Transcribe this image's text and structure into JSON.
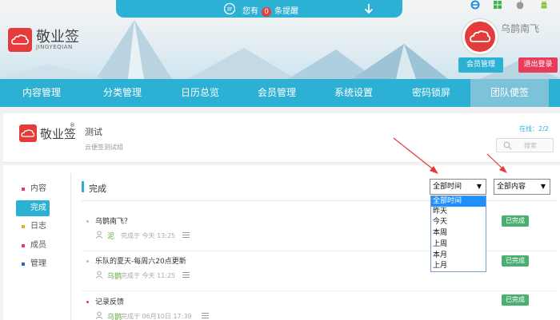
{
  "notice": {
    "prefix": "您有",
    "count": "0",
    "suffix": "条提醒"
  },
  "brand": {
    "name": "敬业签",
    "sub": "JINGYEQIAN"
  },
  "user": {
    "name": "乌鹊南飞",
    "member_btn": "会员管理",
    "logout_btn": "退出登录"
  },
  "nav": [
    {
      "label": "内容管理"
    },
    {
      "label": "分类管理"
    },
    {
      "label": "日历总览"
    },
    {
      "label": "会员管理"
    },
    {
      "label": "系统设置"
    },
    {
      "label": "密码锁屏"
    },
    {
      "label": "团队便签"
    }
  ],
  "team": {
    "logo_text": "敬业签",
    "reg_mark": "®",
    "name": "测试",
    "desc": "云便签测试组",
    "online": "在线：2/2",
    "search_placeholder": "搜索"
  },
  "sidebar": [
    {
      "label": "内容",
      "color": "#e83c5a"
    },
    {
      "label": "完成",
      "color": "#2cb0d4"
    },
    {
      "label": "日志",
      "color": "#f5a623"
    },
    {
      "label": "成员",
      "color": "#e83c5a"
    },
    {
      "label": "管理",
      "color": "#1e6bb8"
    }
  ],
  "section_title": "完成",
  "filters": {
    "time_selected": "全部时间",
    "content_selected": "全部内容",
    "arrow": "▼",
    "time_options": [
      "全部时间",
      "昨天",
      "今天",
      "本周",
      "上周",
      "本月",
      "上月"
    ]
  },
  "items": [
    {
      "title": "乌鹊南飞？",
      "user": "泥",
      "meta": "完成于 今天 13:25",
      "status": "已完成"
    },
    {
      "title": "乐队的夏天-每周六20点更新",
      "user": "乌鹊",
      "meta": "完成于 今天 11:25",
      "status": "已完成"
    },
    {
      "title": "记录反馈",
      "user": "乌鹊",
      "meta": "完成于 06月10日 17:39",
      "status": "已完成"
    }
  ]
}
